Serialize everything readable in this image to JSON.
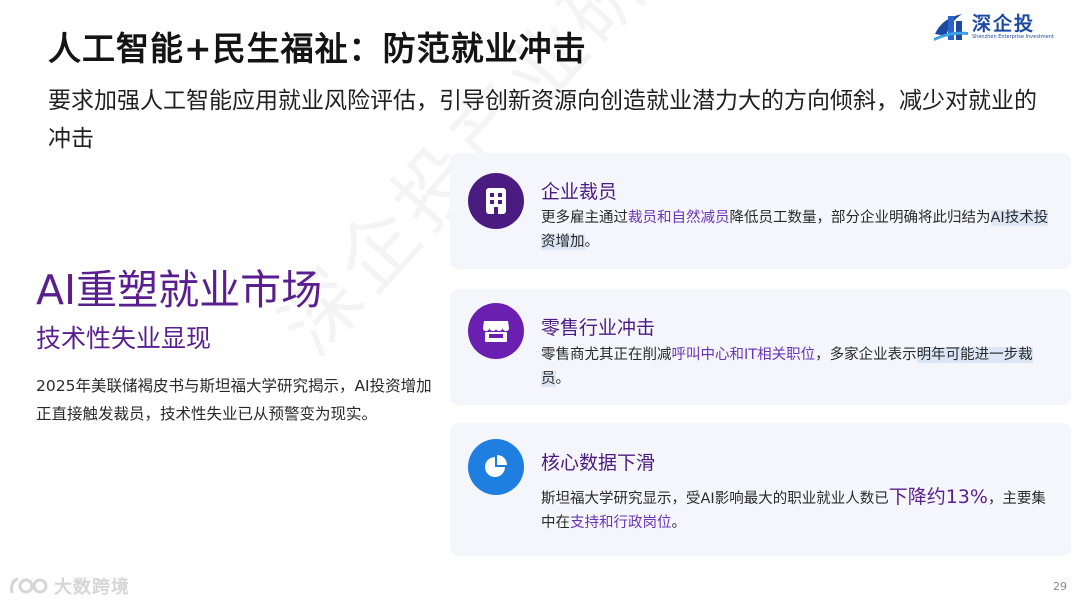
{
  "header": {
    "title": "人工智能+民生福祉：防范就业冲击",
    "subtitle": "要求加强人工智能应用就业风险评估，引导创新资源向创造就业潜力大的方向倾斜，减少对就业的冲击"
  },
  "logo": {
    "name": "深企投",
    "english": "Shenzhen Enterprise Investment",
    "color": "#1d4aa1"
  },
  "watermark": "深企投产业研究院",
  "left": {
    "headline": "AI重塑就业市场",
    "subheadline": "技术性失业显现",
    "body": "2025年美联储褐皮书与斯坦福大学研究揭示，AI投资增加正直接触发裁员，技术性失业已从预警变为现实。"
  },
  "cards": [
    {
      "title": "企业裁员",
      "icon": "building-icon",
      "icon_color": "#4a1c82",
      "body_parts": [
        "更多雇主通过",
        "裁员和自然减员",
        "降低员工数量，部分企业明确将此归结为",
        "AI技术投资增加",
        "。"
      ]
    },
    {
      "title": "零售行业冲击",
      "icon": "store-icon",
      "icon_color": "#6a1fb0",
      "body_parts": [
        "零售商尤其正在削减",
        "呼叫中心和IT相关职位",
        "，多家企业表示",
        "明年可能进一步裁员",
        "。"
      ]
    },
    {
      "title": "核心数据下滑",
      "icon": "pie-chart-icon",
      "icon_color": "#1f7fe0",
      "body_parts": [
        "斯坦福大学研究显示，受AI影响最大的职业就业人数已",
        "下降约13%",
        "，主要集中在",
        "支持和行政岗位",
        "。"
      ]
    }
  ],
  "footer": {
    "brand": "大数跨境",
    "page_number": "29"
  },
  "colors": {
    "accent_purple": "#5a1f8f",
    "highlight_bg": "#dbe6f6",
    "card_bg": "#f5f6fb"
  }
}
